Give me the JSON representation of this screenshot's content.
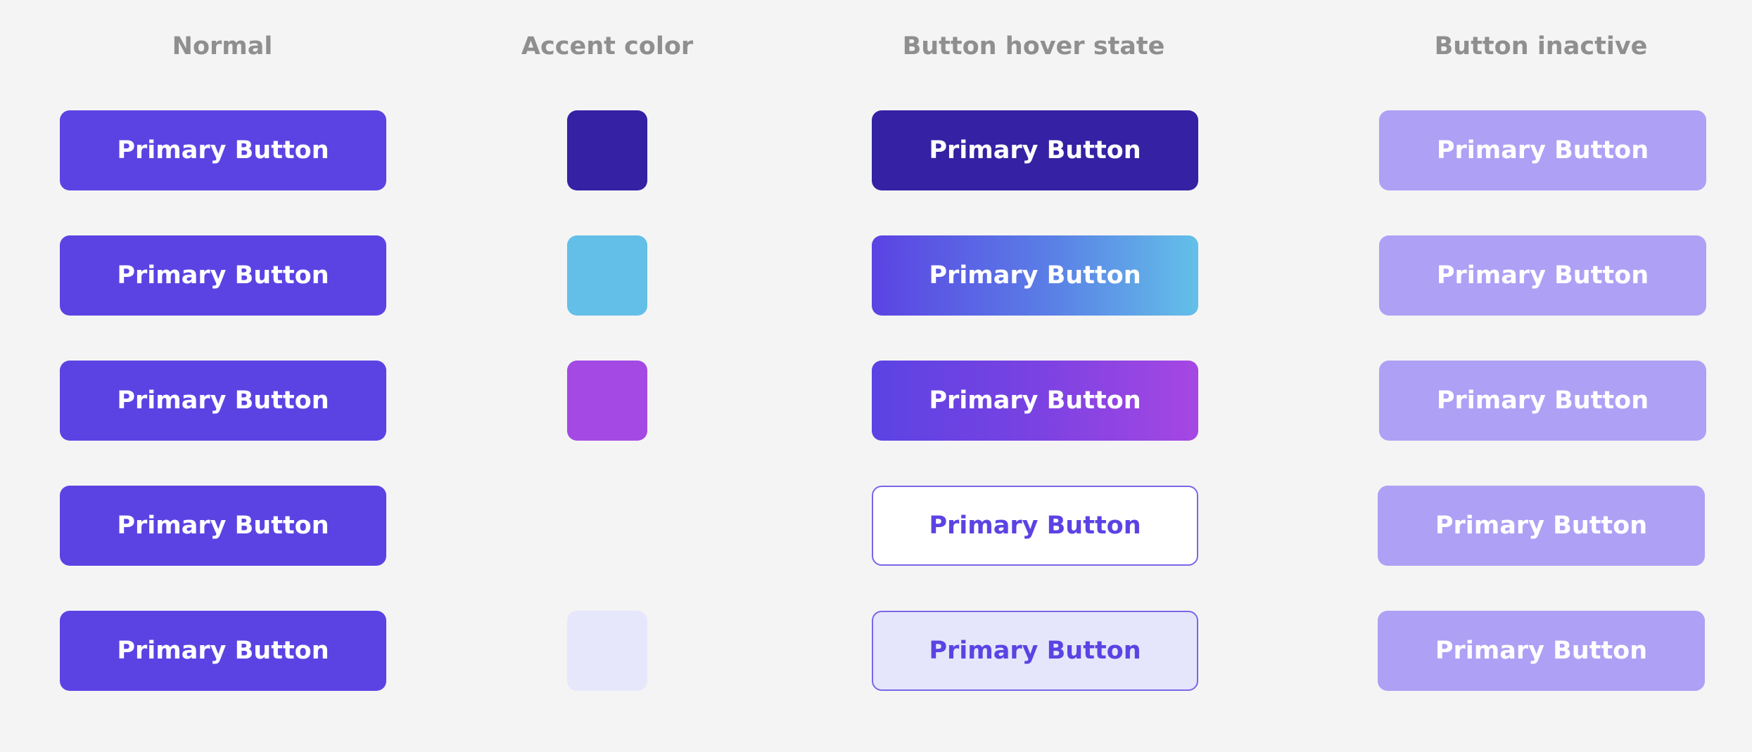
{
  "headers": {
    "normal": "Normal",
    "accent": "Accent color",
    "hover": "Button hover state",
    "inactive": "Button inactive"
  },
  "button_label": "Primary Button",
  "rows": [
    {
      "accent_color": "#3421a3",
      "hover_style": "dark solid #3421a3"
    },
    {
      "accent_color": "#63bfe8",
      "hover_style": "gradient #5b43e3 to #63c0e8"
    },
    {
      "accent_color": "#a449e4",
      "hover_style": "gradient #5b43e3 to #a647e3"
    },
    {
      "accent_color": "",
      "hover_style": "white with #7a66e8 outline"
    },
    {
      "accent_color": "#e6e7fb",
      "hover_style": "light #e5e6fb with #7a66e8 outline"
    }
  ],
  "colors": {
    "background": "#f4f4f4",
    "primary": "#5b43e3",
    "inactive": "#aea0f5",
    "header_text": "#8f8f8f",
    "outline": "#7a66e8"
  }
}
